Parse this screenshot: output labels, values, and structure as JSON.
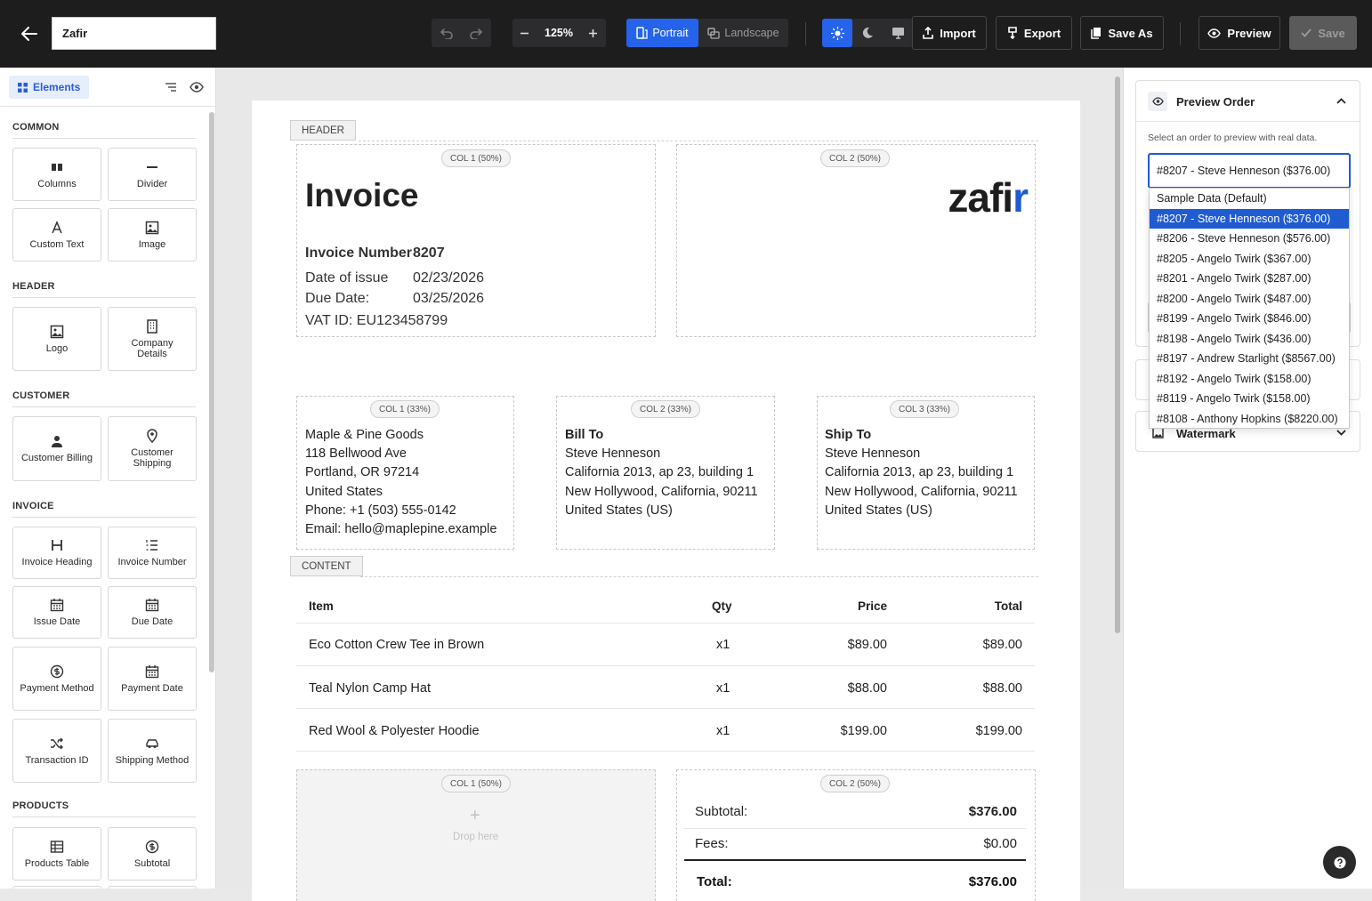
{
  "topbar": {
    "doc_name": "Zafir",
    "zoom": "125%",
    "orientation": {
      "portrait": "Portrait",
      "landscape": "Landscape"
    },
    "import_label": "Import",
    "export_label": "Export",
    "save_as_label": "Save As",
    "preview_label": "Preview",
    "save_label": "Save"
  },
  "sidebar": {
    "tab_label": "Elements",
    "sections": [
      {
        "title": "COMMON",
        "items": [
          "Columns",
          "Divider",
          "Custom Text",
          "Image"
        ]
      },
      {
        "title": "HEADER",
        "items": [
          "Logo",
          "Company Details"
        ]
      },
      {
        "title": "CUSTOMER",
        "items": [
          "Customer Billing",
          "Customer Shipping"
        ]
      },
      {
        "title": "INVOICE",
        "items": [
          "Invoice Heading",
          "Invoice Number",
          "Issue Date",
          "Due Date",
          "Payment Method",
          "Payment Date",
          "Transaction ID",
          "Shipping Method"
        ]
      },
      {
        "title": "PRODUCTS",
        "items": [
          "Products Table",
          "Subtotal"
        ]
      }
    ]
  },
  "invoice": {
    "header_tag": "HEADER",
    "content_tag": "CONTENT",
    "col_50_1": "COL 1 (50%)",
    "col_50_2": "COL 2 (50%)",
    "col_33_1": "COL 1 (33%)",
    "col_33_2": "COL 2 (33%)",
    "col_33_3": "COL 3 (33%)",
    "title": "Invoice",
    "number_label": "Invoice Number",
    "number_value": "8207",
    "issue_label": "Date of issue",
    "issue_value": "02/23/2026",
    "due_label": "Due Date:",
    "due_value": "03/25/2026",
    "vat": "VAT ID: EU123458799",
    "logo_text_main": "zafi",
    "logo_text_accent": "r",
    "logo_accent_color": "#1f5bd1",
    "company": [
      "Maple & Pine Goods",
      "118 Bellwood Ave",
      "Portland, OR 97214",
      "United States",
      "Phone: +1 (503) 555-0142",
      "Email: hello@maplepine.example"
    ],
    "bill_to_title": "Bill To",
    "bill_to": [
      "Steve Henneson",
      "California 2013, ap 23, building 1",
      "New Hollywood, California, 90211",
      "United States (US)"
    ],
    "ship_to_title": "Ship To",
    "ship_to": [
      "Steve Henneson",
      "California 2013, ap 23, building 1",
      "New Hollywood, California, 90211",
      "United States (US)"
    ],
    "table_headers": [
      "Item",
      "Qty",
      "Price",
      "Total"
    ],
    "rows": [
      [
        "Eco Cotton Crew Tee in Brown",
        "x1",
        "$89.00",
        "$89.00"
      ],
      [
        "Teal Nylon Camp Hat",
        "x1",
        "$88.00",
        "$88.00"
      ],
      [
        "Red Wool & Polyester Hoodie",
        "x1",
        "$199.00",
        "$199.00"
      ]
    ],
    "drop_here": "Drop here",
    "subtotal_label": "Subtotal:",
    "subtotal_value": "$376.00",
    "fees_label": "Fees:",
    "fees_value": "$0.00",
    "total_label": "Total:",
    "total_value": "$376.00"
  },
  "preview_panel": {
    "title": "Preview Order",
    "hint": "Select an order to preview with real data.",
    "selected": "#8207 - Steve Henneson ($376.00)",
    "options": [
      "Sample Data (Default)",
      "#8207 - Steve Henneson ($376.00)",
      "#8206 - Steve Henneson ($576.00)",
      "#8205 - Angelo Twirk ($367.00)",
      "#8201 - Angelo Twirk ($287.00)",
      "#8200 - Angelo Twirk ($487.00)",
      "#8199 - Angelo Twirk ($846.00)",
      "#8198 - Angelo Twirk ($436.00)",
      "#8197 - Andrew Starlight ($8567.00)",
      "#8192 - Angelo Twirk ($158.00)",
      "#8119 - Angelo Twirk ($158.00)",
      "#8108 - Anthony Hopkins ($8220.00)"
    ],
    "watermark_label": "Watermark"
  },
  "colors": {
    "accent": "#1f5bd1",
    "topbar": "#1d1d1d"
  }
}
